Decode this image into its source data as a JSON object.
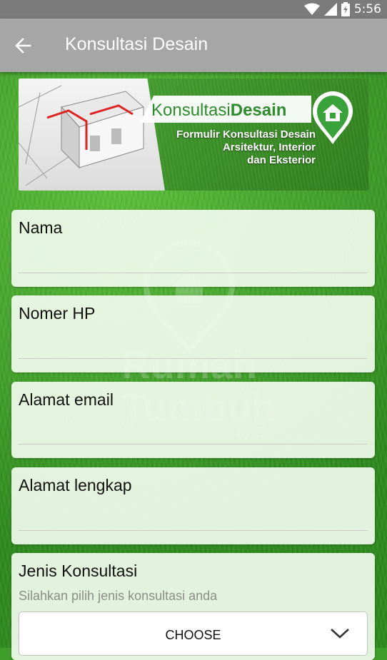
{
  "status_bar": {
    "time": "5:56",
    "icons": [
      "wifi-icon",
      "signal-icon",
      "battery-icon"
    ]
  },
  "toolbar": {
    "title": "Konsultasi Desain",
    "back_icon": "arrow-left-icon"
  },
  "banner": {
    "brand_plain": "Konsultasi",
    "brand_bold": "Desain",
    "subtitle_line1": "Formulir Konsultasi Desain",
    "subtitle_line2": "Arsitektur, Interior",
    "subtitle_line3": "dan Eksterior"
  },
  "watermark": {
    "line1": "Rumah",
    "line2": "Tumbuh",
    "line3": "by Zie"
  },
  "form": {
    "name_label": "Nama",
    "phone_label": "Nomer HP",
    "email_label": "Alamat email",
    "address_label": "Alamat lengkap",
    "consult_label": "Jenis Konsultasi",
    "consult_hint": "Silahkan pilih jenis konsultasi anda",
    "consult_selected": "CHOOSE"
  },
  "colors": {
    "toolbar": "#a6a6a6",
    "statusbar": "#7b7b7b",
    "brand_green": "#2e8b2e",
    "grass": "#3f9e2a"
  }
}
